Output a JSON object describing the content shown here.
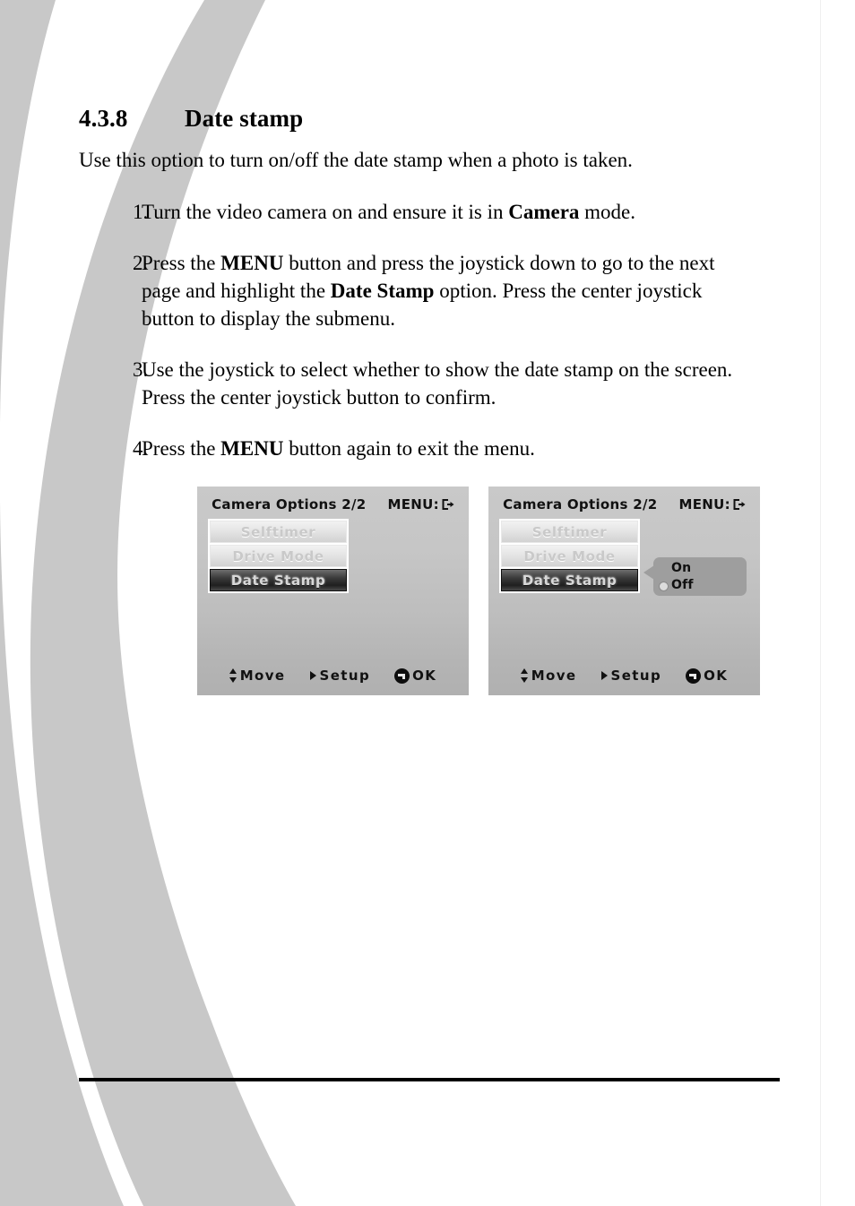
{
  "document": {
    "section_number": "4.3.8",
    "section_title": "Date stamp",
    "intro_text": "Use this option to turn on/off the date stamp when a photo is taken.",
    "steps": [
      {
        "number": "1.",
        "parts": [
          {
            "text": "Turn the video camera on and ensure it is in ",
            "bold": false
          },
          {
            "text": "Camera",
            "bold": true
          },
          {
            "text": " mode.",
            "bold": false
          }
        ]
      },
      {
        "number": "2.",
        "parts": [
          {
            "text": "Press the ",
            "bold": false
          },
          {
            "text": "MENU",
            "bold": true
          },
          {
            "text": " button and press the joystick down to go to the next page and highlight the ",
            "bold": false
          },
          {
            "text": "Date Stamp",
            "bold": true
          },
          {
            "text": " option. Press the center joystick button to display the submenu.",
            "bold": false
          }
        ]
      },
      {
        "number": "3.",
        "parts": [
          {
            "text": "Use the joystick to select whether to show the date stamp on the screen. Press the center joystick button to confirm.",
            "bold": false
          }
        ]
      },
      {
        "number": "4.",
        "parts": [
          {
            "text": "Press the ",
            "bold": false
          },
          {
            "text": "MENU",
            "bold": true
          },
          {
            "text": " button again to exit the menu.",
            "bold": false
          }
        ]
      }
    ]
  },
  "screens": {
    "left": {
      "header_title": "Camera Options 2/2",
      "header_menu_label": "MENU:",
      "header_menu_icon": "exit-icon",
      "menu_items": [
        {
          "label": "Selftimer",
          "state": "dim"
        },
        {
          "label": "Drive Mode",
          "state": "dim"
        },
        {
          "label": "Date Stamp",
          "state": "active"
        }
      ],
      "submenu_visible": false,
      "footer": [
        {
          "icon": "up-down-arrow-icon",
          "label": "Move"
        },
        {
          "icon": "right-triangle-icon",
          "label": "Setup"
        },
        {
          "icon": "enter-button-icon",
          "label": "OK"
        }
      ]
    },
    "right": {
      "header_title": "Camera Options 2/2",
      "header_menu_label": "MENU:",
      "header_menu_icon": "exit-icon",
      "menu_items": [
        {
          "label": "Selftimer",
          "state": "dim"
        },
        {
          "label": "Drive Mode",
          "state": "dim"
        },
        {
          "label": "Date Stamp",
          "state": "active"
        }
      ],
      "submenu_visible": true,
      "submenu_options": [
        {
          "label": "On",
          "selected": false
        },
        {
          "label": "Off",
          "selected": true
        }
      ],
      "footer": [
        {
          "icon": "up-down-arrow-icon",
          "label": "Move"
        },
        {
          "icon": "right-triangle-icon",
          "label": "Setup"
        },
        {
          "icon": "enter-button-icon",
          "label": "OK"
        }
      ]
    }
  },
  "colors": {
    "swoosh_grey": "#c8c8c8",
    "page_background": "#ffffff",
    "text": "#000000",
    "lcd_background": "#c4c4c4",
    "lcd_highlight": "#2a2a2a",
    "submenu_background": "#9e9e9e",
    "footer_rule": "#000000"
  }
}
